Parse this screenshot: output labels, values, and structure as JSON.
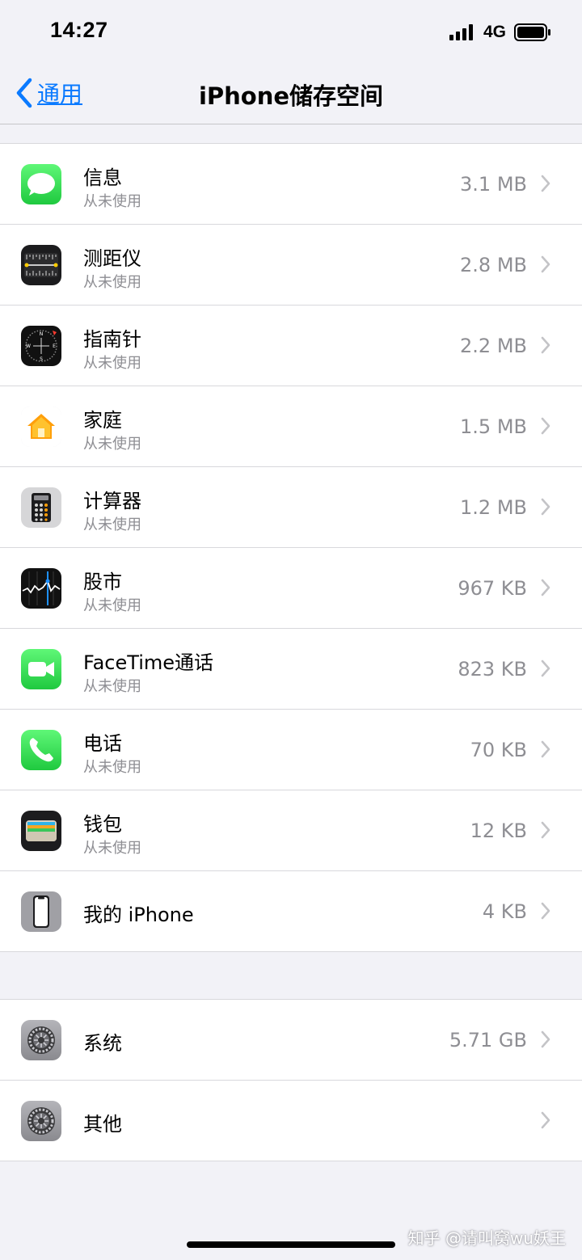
{
  "status": {
    "time": "14:27",
    "network": "4G"
  },
  "nav": {
    "back_label": "通用",
    "title": "iPhone储存空间"
  },
  "apps": [
    {
      "name": "信息",
      "sub": "从未使用",
      "size": "3.1 MB",
      "icon": "messages-icon"
    },
    {
      "name": "测距仪",
      "sub": "从未使用",
      "size": "2.8 MB",
      "icon": "measure-icon"
    },
    {
      "name": "指南针",
      "sub": "从未使用",
      "size": "2.2 MB",
      "icon": "compass-icon"
    },
    {
      "name": "家庭",
      "sub": "从未使用",
      "size": "1.5 MB",
      "icon": "home-icon"
    },
    {
      "name": "计算器",
      "sub": "从未使用",
      "size": "1.2 MB",
      "icon": "calculator-icon"
    },
    {
      "name": "股市",
      "sub": "从未使用",
      "size": "967 KB",
      "icon": "stocks-icon"
    },
    {
      "name": "FaceTime通话",
      "sub": "从未使用",
      "size": "823 KB",
      "icon": "facetime-icon"
    },
    {
      "name": "电话",
      "sub": "从未使用",
      "size": "70 KB",
      "icon": "phone-icon"
    },
    {
      "name": "钱包",
      "sub": "从未使用",
      "size": "12 KB",
      "icon": "wallet-icon"
    },
    {
      "name": "我的 iPhone",
      "size": "4 KB",
      "icon": "iphone-icon"
    }
  ],
  "system": [
    {
      "name": "系统",
      "size": "5.71 GB",
      "icon": "gear-icon"
    },
    {
      "name": "其他",
      "size": "",
      "icon": "gear-icon"
    }
  ],
  "watermark": "知乎 @请叫窝wu妖王",
  "colors": {
    "accent": "#0a7aff",
    "secondary_text": "#8e8e93",
    "background": "#f2f2f7"
  }
}
